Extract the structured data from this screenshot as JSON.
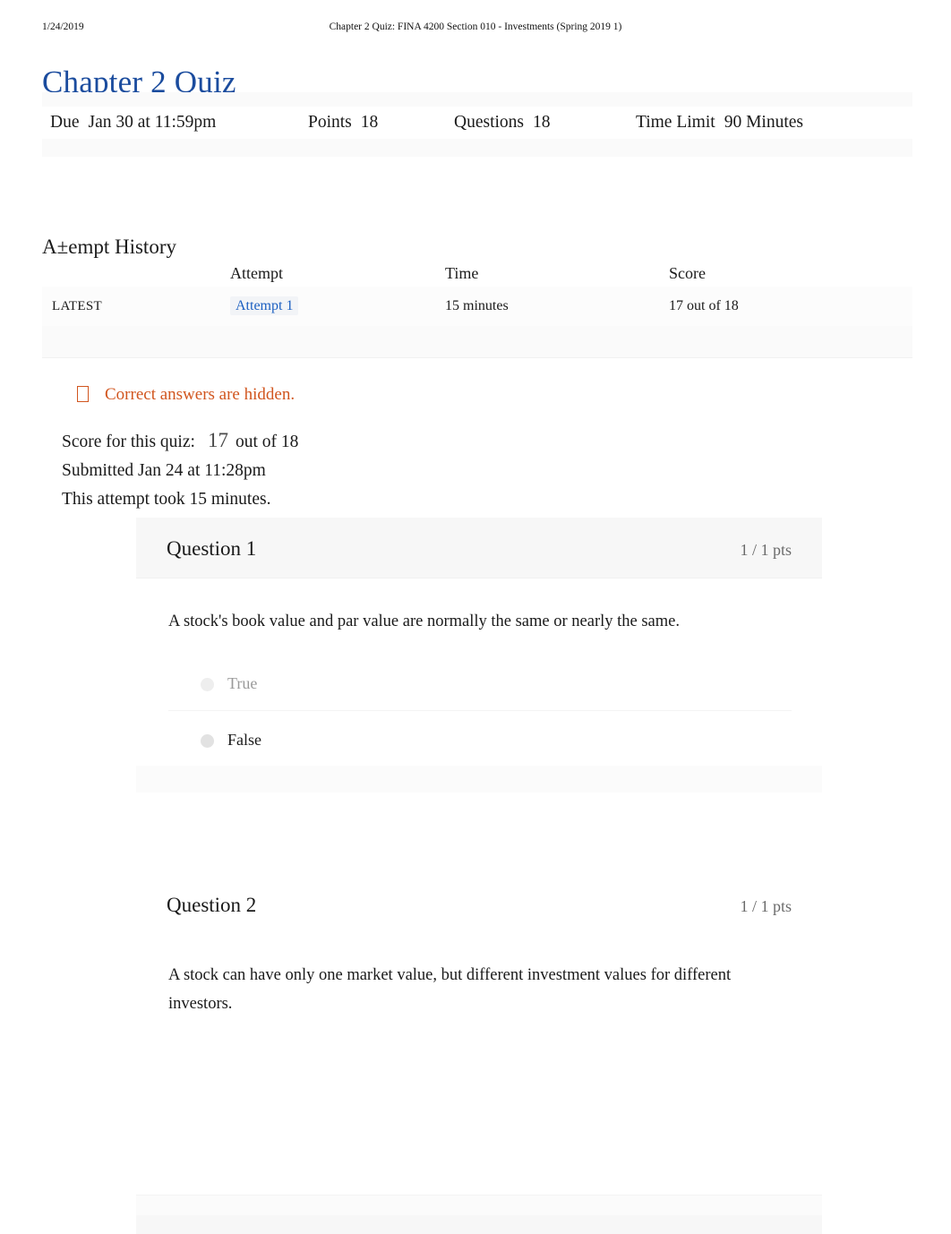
{
  "print_header": {
    "date": "1/24/2019",
    "document_title": "Chapter 2 Quiz: FINA 4200 Section 010 - Investments (Spring 2019 1)"
  },
  "page_title": "Chapter 2 Quiz",
  "quiz_meta": {
    "due_label": "Due",
    "due_value": "Jan 30 at 11:59pm",
    "points_label": "Points",
    "points_value": "18",
    "questions_label": "Questions",
    "questions_value": "18",
    "time_limit_label": "Time Limit",
    "time_limit_value": "90 Minutes"
  },
  "attempt_history": {
    "heading": "A±empt History",
    "columns": [
      "",
      "Attempt",
      "Time",
      "Score"
    ],
    "rows": [
      {
        "tag": "LATEST",
        "attempt": "Attempt 1",
        "time": "15 minutes",
        "score": "17 out of 18"
      }
    ]
  },
  "notice": {
    "icon": "info-box-icon",
    "text": "Correct answers are hidden.",
    "color": "#d1561f"
  },
  "score_summary": {
    "score_label": "Score for this quiz:",
    "score_value": "17",
    "score_out_of": "out of 18",
    "submitted": "Submitted Jan 24 at 11:28pm",
    "duration": "This attempt took 15 minutes."
  },
  "questions": [
    {
      "title": "Question 1",
      "points": "1 / 1 pts",
      "text": "A stock's book value and par value are normally the same or nearly the same.",
      "answers": [
        {
          "label": "True",
          "selected": false
        },
        {
          "label": "False",
          "selected": true
        }
      ]
    },
    {
      "title": "Question 2",
      "points": "1 / 1 pts",
      "text": "A stock can have only one market value, but different investment values for different investors.",
      "answers": []
    }
  ],
  "colors": {
    "title_blue": "#1b4c9e",
    "link_blue": "#1b5fc1",
    "notice_orange": "#d1561f",
    "muted_gray": "#6b6b6b"
  }
}
